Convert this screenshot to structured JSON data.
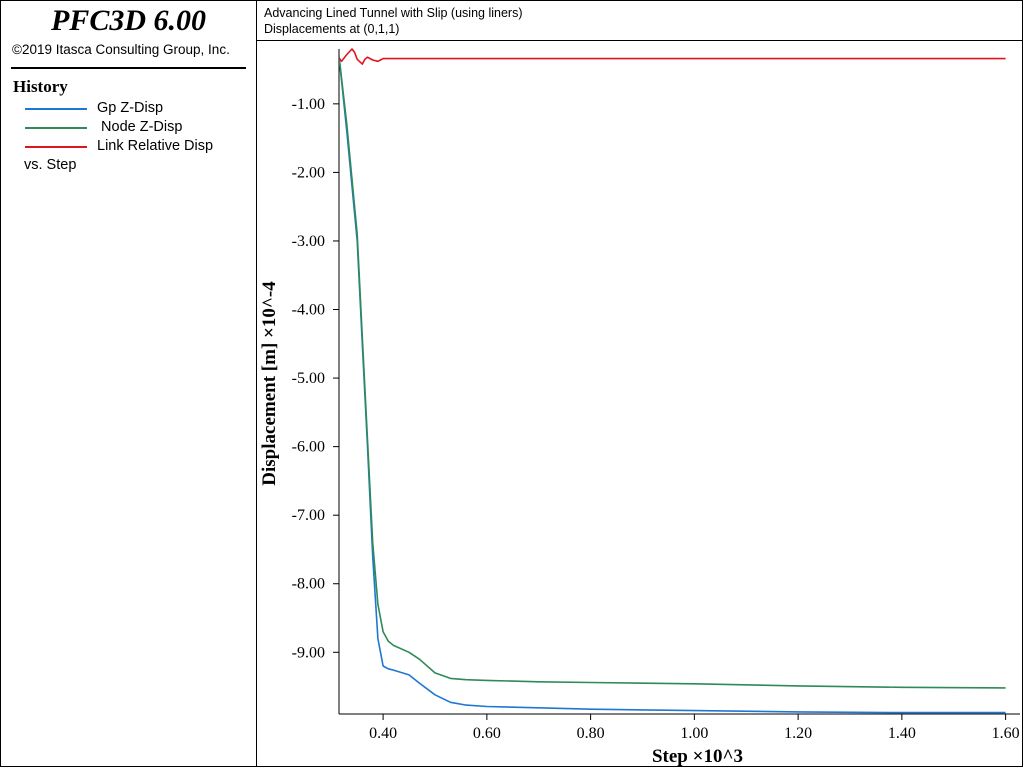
{
  "app": {
    "title": "PFC3D 6.00",
    "copyright": "©2019 Itasca Consulting Group, Inc."
  },
  "legend": {
    "heading": "History",
    "items": [
      {
        "label": "Gp Z-Disp",
        "color": "#1f77d4"
      },
      {
        "label": " Node Z-Disp",
        "color": "#2e8b57"
      },
      {
        "label": "Link Relative Disp",
        "color": "#e0141e"
      }
    ],
    "vs_label": "vs. Step"
  },
  "plot": {
    "header_line1": "Advancing Lined Tunnel with Slip (using liners)",
    "header_line2": "Displacements at (0,1,1)"
  },
  "chart_data": {
    "type": "line",
    "xlabel": "Step ×10^3",
    "ylabel": "Displacement [m] ×10^-4",
    "xlim": [
      0.315,
      1.62
    ],
    "ylim": [
      -9.9,
      -0.2
    ],
    "x_ticks": [
      0.4,
      0.6,
      0.8,
      1.0,
      1.2,
      1.4,
      1.6
    ],
    "x_tick_labels": [
      "0.40",
      "0.60",
      "0.80",
      "1.00",
      "1.20",
      "1.40",
      "1.60"
    ],
    "y_ticks": [
      -1.0,
      -2.0,
      -3.0,
      -4.0,
      -5.0,
      -6.0,
      -7.0,
      -8.0,
      -9.0
    ],
    "y_tick_labels": [
      "-1.00",
      "-2.00",
      "-3.00",
      "-4.00",
      "-5.00",
      "-6.00",
      "-7.00",
      "-8.00",
      "-9.00"
    ],
    "grid": false,
    "series": [
      {
        "name": "Gp Z-Disp",
        "color": "#1f77d4",
        "x": [
          0.315,
          0.33,
          0.35,
          0.36,
          0.37,
          0.38,
          0.39,
          0.4,
          0.41,
          0.42,
          0.45,
          0.47,
          0.5,
          0.53,
          0.56,
          0.6,
          0.7,
          0.8,
          1.0,
          1.2,
          1.4,
          1.6
        ],
        "y": [
          -0.3,
          -1.4,
          -3.0,
          -4.5,
          -6.0,
          -7.6,
          -8.8,
          -9.2,
          -9.24,
          -9.26,
          -9.33,
          -9.45,
          -9.62,
          -9.73,
          -9.77,
          -9.79,
          -9.81,
          -9.83,
          -9.85,
          -9.87,
          -9.88,
          -9.88
        ]
      },
      {
        "name": " Node Z-Disp",
        "color": "#2e8b57",
        "x": [
          0.315,
          0.33,
          0.35,
          0.36,
          0.37,
          0.38,
          0.39,
          0.4,
          0.41,
          0.42,
          0.45,
          0.47,
          0.5,
          0.53,
          0.56,
          0.6,
          0.7,
          0.8,
          1.0,
          1.2,
          1.4,
          1.6
        ],
        "y": [
          -0.3,
          -1.3,
          -2.9,
          -4.4,
          -5.9,
          -7.4,
          -8.3,
          -8.7,
          -8.84,
          -8.9,
          -9.0,
          -9.1,
          -9.3,
          -9.38,
          -9.4,
          -9.41,
          -9.43,
          -9.44,
          -9.46,
          -9.49,
          -9.51,
          -9.52
        ]
      },
      {
        "name": "Link Relative Disp",
        "color": "#e0141e",
        "x": [
          0.315,
          0.32,
          0.33,
          0.34,
          0.345,
          0.35,
          0.36,
          0.365,
          0.37,
          0.38,
          0.39,
          0.4,
          0.45,
          0.6,
          0.8,
          1.0,
          1.2,
          1.4,
          1.6
        ],
        "y": [
          -0.33,
          -0.38,
          -0.28,
          -0.2,
          -0.25,
          -0.35,
          -0.42,
          -0.35,
          -0.32,
          -0.36,
          -0.38,
          -0.34,
          -0.34,
          -0.34,
          -0.34,
          -0.34,
          -0.34,
          -0.34,
          -0.34
        ]
      }
    ]
  }
}
